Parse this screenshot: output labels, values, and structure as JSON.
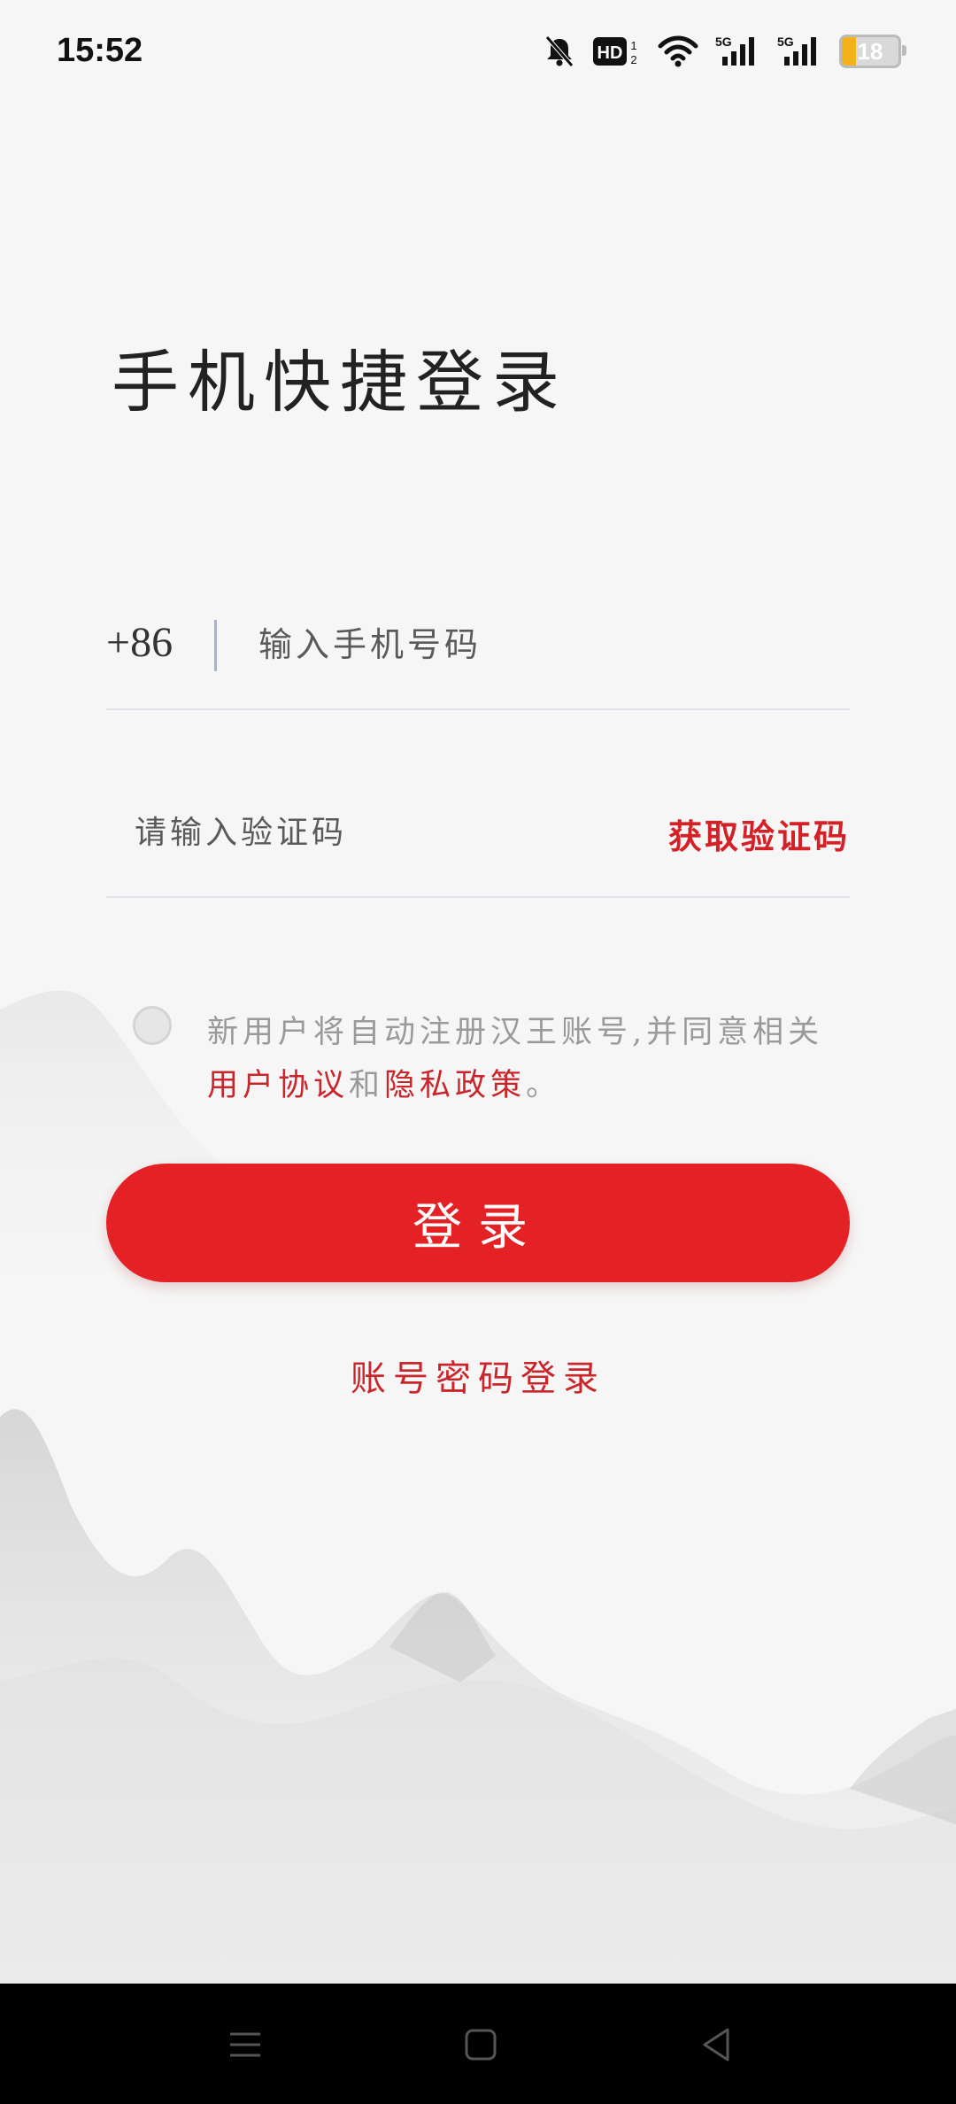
{
  "status_bar": {
    "time": "15:52",
    "icons": [
      "bell-muted-icon",
      "hd-icon",
      "wifi-icon",
      "5g-signal-icon",
      "5g-signal-icon",
      "battery-icon"
    ],
    "battery_level": "18",
    "battery_color": "#f2b21b"
  },
  "page": {
    "title": "手机快捷登录"
  },
  "phone": {
    "country_code": "+86",
    "placeholder": "输入手机号码",
    "value": ""
  },
  "verification": {
    "placeholder": "请输入验证码",
    "value": "",
    "get_code_label": "获取验证码"
  },
  "agreement": {
    "checked": false,
    "text": "新用户将自动注册汉王账号,并同意相关",
    "user_agreement": "用户协议",
    "conjunction": "和",
    "privacy_policy": "隐私政策",
    "end": "。"
  },
  "login_button": {
    "label": "登录",
    "color": "#e42125"
  },
  "alt_login": {
    "label": "账号密码登录"
  },
  "colors": {
    "accent": "#d42127",
    "background": "#f6f6f6"
  },
  "nav_bar": {
    "items": [
      "menu-icon",
      "home-icon",
      "back-icon"
    ]
  }
}
